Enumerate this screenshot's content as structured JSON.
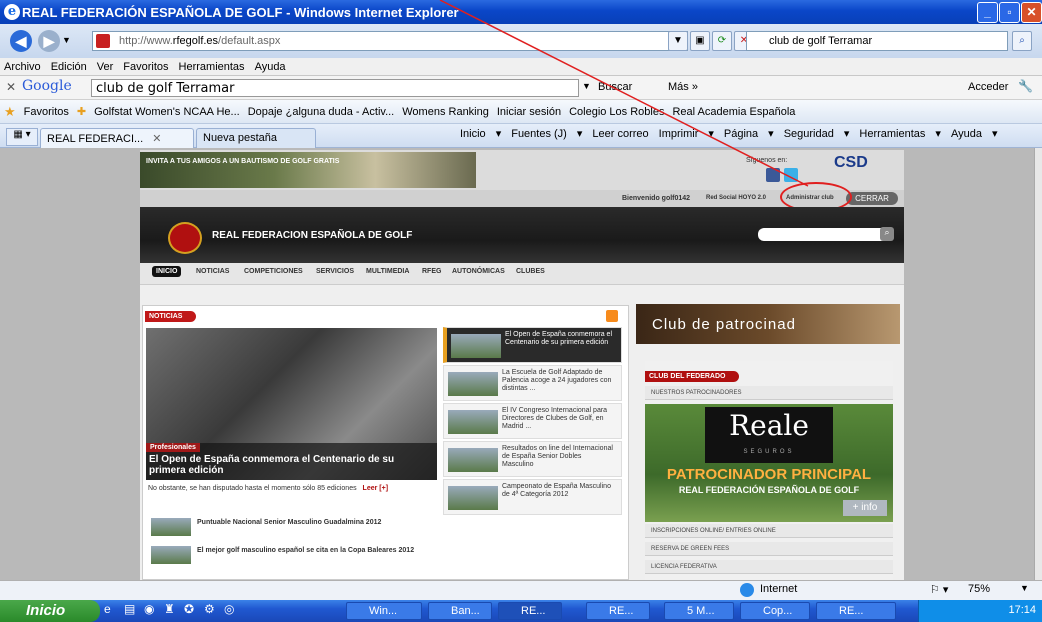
{
  "window": {
    "title": "REAL FEDERACIÓN ESPAÑOLA DE GOLF - Windows Internet Explorer"
  },
  "address": {
    "prefix": "http://www.",
    "domain": "rfegolf.es",
    "suffix": "/default.aspx"
  },
  "search_provider": {
    "value": "club de golf Terramar"
  },
  "menu": [
    "Archivo",
    "Edición",
    "Ver",
    "Favoritos",
    "Herramientas",
    "Ayuda"
  ],
  "google_bar": {
    "logo": "Google",
    "query": "club de golf Terramar",
    "buscar": "Buscar",
    "mas": "Más »",
    "acceder": "Acceder"
  },
  "favorites": {
    "label": "Favoritos",
    "items": [
      "Golfstat Women's NCAA He...",
      "Dopaje ¿alguna duda - Activ...",
      "Womens Ranking",
      "Iniciar sesión",
      "Colegio Los Robles",
      "Real Academia Española"
    ]
  },
  "tabs": [
    {
      "label": "REAL FEDERACI..."
    },
    {
      "label": "Nueva pestaña"
    }
  ],
  "commands": [
    "Inicio",
    "Fuentes (J)",
    "Leer correo",
    "Imprimir",
    "Página",
    "Seguridad",
    "Herramientas",
    "Ayuda"
  ],
  "site": {
    "promo": "INVITA A TUS AMIGOS A UN BAUTISMO DE GOLF GRATIS",
    "siguenos": "Síguenos en:",
    "welcome": "Bienvenido golf0142",
    "red_social": "Red Social HOYO 2.0",
    "administrar": "Administrar club",
    "cerrar": "CERRAR",
    "title": "REAL FEDERACION ESPAÑOLA DE GOLF",
    "nav": [
      "INICIO",
      "NOTICIAS",
      "COMPETICIONES",
      "SERVICIOS",
      "MULTIMEDIA",
      "RFEG",
      "AUTONÓMICAS",
      "CLUBES"
    ],
    "noticias": "NOTICIAS",
    "main_tag": "Profesionales",
    "main_title": "El Open de España conmemora el Centenario de su primera edición",
    "lead": "No obstante, se han disputado hasta el momento sólo 85 ediciones",
    "leer": "Leer [+]",
    "side_news": [
      "El Open de España conmemora el Centenario de su primera edición",
      "La Escuela de Golf Adaptado de Palencia acoge a 24 jugadores con distintas ...",
      "El IV Congreso Internacional para Directores de Clubes de Golf, en Madrid ...",
      "Resultados on line del Internacional de España Senior Dobles Masculino",
      "Campeonato de España Masculino de 4ª Categoría 2012"
    ],
    "bottom_news": [
      "Puntuable Nacional Senior Masculino Guadalmina 2012",
      "El mejor golf masculino español se cita en la Copa Baleares 2012"
    ],
    "club_banner": "Club de patrocinad",
    "club_federado": "CLUB DEL FEDERADO",
    "patrocinadores": "NUESTROS PATROCINADORES",
    "reale": "Reale",
    "reale_sub": "SEGUROS",
    "patrocinador": "PATROCINADOR PRINCIPAL",
    "rfeg_line": "REAL FEDERACIÓN ESPAÑOLA DE GOLF",
    "info": "+ info",
    "links": [
      "INSCRIPCIONES ONLINE/ ENTRIES ONLINE",
      "RESERVA DE GREEN FEES",
      "LICENCIA FEDERATIVA"
    ]
  },
  "status": {
    "zone": "Internet",
    "zoom": "75%"
  },
  "taskbar": {
    "start": "Inicio",
    "tasks": [
      "Win...",
      "Ban...",
      "RE...",
      "RE...",
      "5 M...",
      "Cop...",
      "RE..."
    ],
    "clock": "17:14"
  }
}
